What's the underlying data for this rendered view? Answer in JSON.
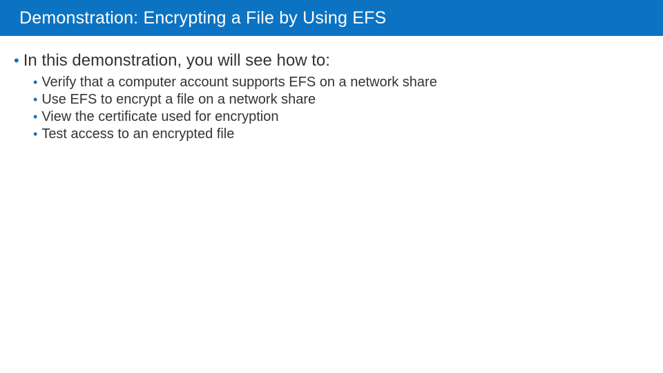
{
  "title": "Demonstration: Encrypting a File by Using EFS",
  "intro": "In this demonstration, you will see how to:",
  "items": [
    "Verify that a computer account supports EFS on a network share",
    "Use EFS to encrypt a file on a network share",
    "View the certificate used for encryption",
    "Test access to an encrypted file"
  ],
  "colors": {
    "accent": "#0c73c2"
  }
}
